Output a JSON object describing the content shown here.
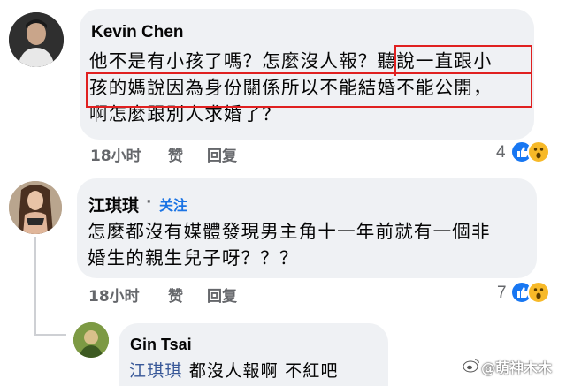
{
  "comments": [
    {
      "author": "Kevin Chen",
      "lines": [
        "他不是有小孩了嗎？怎麼沒人報？聽說一直跟小",
        "孩的媽說因為身份關係所以不能結婚不能公開，",
        "啊怎麼跟別人求婚了？"
      ],
      "time": "18小时",
      "like_label": "赞",
      "reply_label": "回复",
      "reaction_count": "4"
    },
    {
      "author": "江琪琪",
      "follow_separator": "·",
      "follow_label": "关注",
      "lines": [
        "怎麼都沒有媒體發現男主角十一年前就有一個非",
        "婚生的親生兒子呀？？？"
      ],
      "time": "18小时",
      "like_label": "赞",
      "reply_label": "回复",
      "reaction_count": "7"
    },
    {
      "author": "Gin Tsai",
      "mention": "江琪琪",
      "text": " 都沒人報啊 不紅吧"
    }
  ],
  "watermark": "@萌神木木",
  "colors": {
    "bubble": "#eff1f4",
    "highlight": "#e02020",
    "like_blue": "#1877f2",
    "wow_yellow": "#f7b928",
    "mention": "#385898"
  },
  "icons": [
    "like-reaction-icon",
    "wow-reaction-icon",
    "weibo-logo-icon"
  ]
}
